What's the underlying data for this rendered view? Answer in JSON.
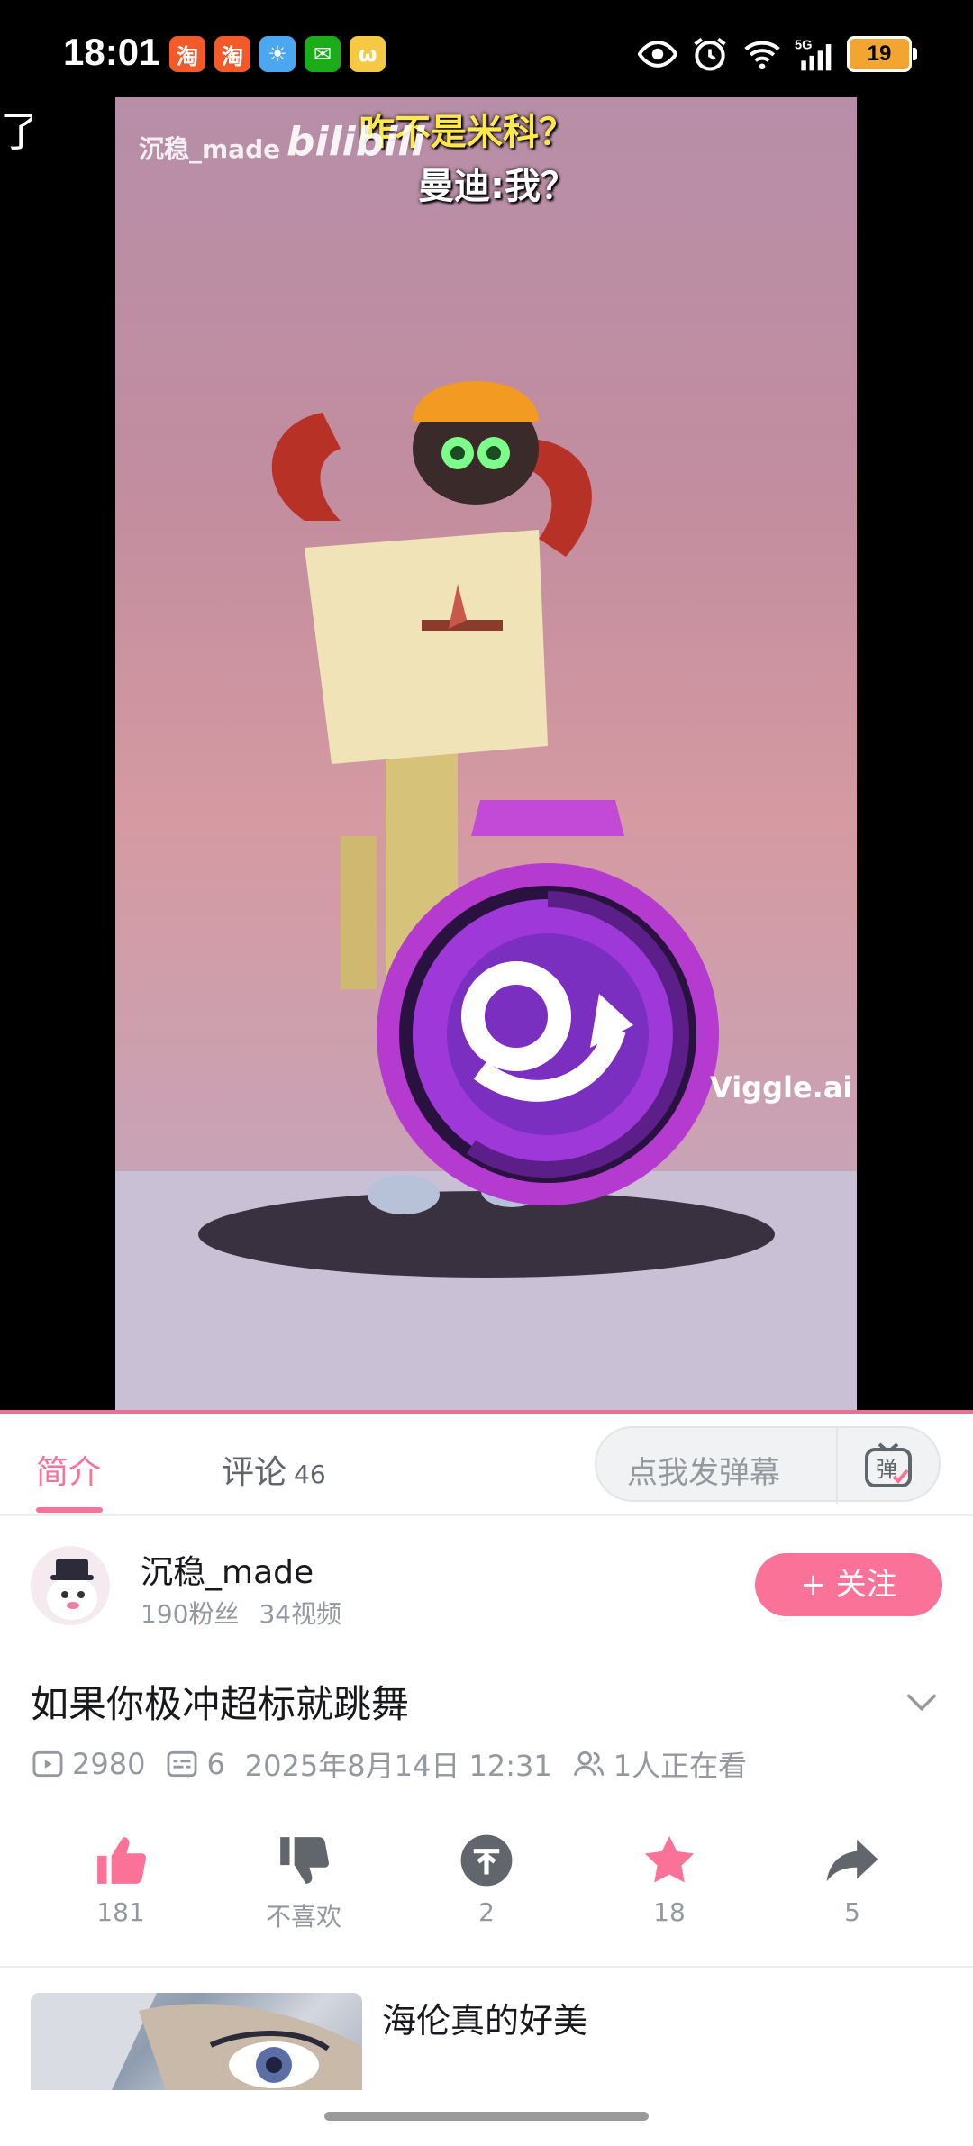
{
  "status_bar": {
    "time": "18:01",
    "apps": [
      {
        "name": "taobao-app-icon",
        "glyph": "淘",
        "color": "#f25a2a"
      },
      {
        "name": "taobao-app-icon-2",
        "glyph": "淘",
        "color": "#f25a2a"
      },
      {
        "name": "weather-app-icon",
        "glyph": "☀",
        "color": "#4aa7f0"
      },
      {
        "name": "wechat-app-icon",
        "glyph": "✉",
        "color": "#1aad19"
      },
      {
        "name": "rabbit-app-icon",
        "glyph": "ω",
        "color": "#f6c945"
      }
    ],
    "network": "5G",
    "battery": "19"
  },
  "left_edge_text": "了",
  "video": {
    "watermark": "沉稳_made",
    "platform_logo": "bilibili",
    "caption_line1": "咋不是米科？",
    "caption_line2": "曼迪:我？",
    "corner_watermark": "Viggle.ai"
  },
  "tabs": {
    "intro_label": "简介",
    "comments_label": "评论",
    "comments_count": "46",
    "danmaku_placeholder": "点我发弹幕",
    "danmaku_icon_glyph": "弹"
  },
  "uploader": {
    "name": "沉稳_made",
    "fans": "190粉丝",
    "videos": "34视频",
    "follow_label": "+ 关注"
  },
  "video_info": {
    "title": "如果你极冲超标就跳舞",
    "views": "2980",
    "danmaku_count": "6",
    "publish_time": "2025年8月14日 12:31",
    "watching": "1人正在看"
  },
  "actions": {
    "like": "181",
    "dislike": "不喜欢",
    "coin": "2",
    "favorite": "18",
    "share": "5"
  },
  "recommendation": {
    "title": "海伦真的好美"
  },
  "colors": {
    "accent": "#fb7299",
    "text_primary": "#18191c",
    "text_secondary": "#9499a0",
    "icon_gray": "#61666d"
  }
}
